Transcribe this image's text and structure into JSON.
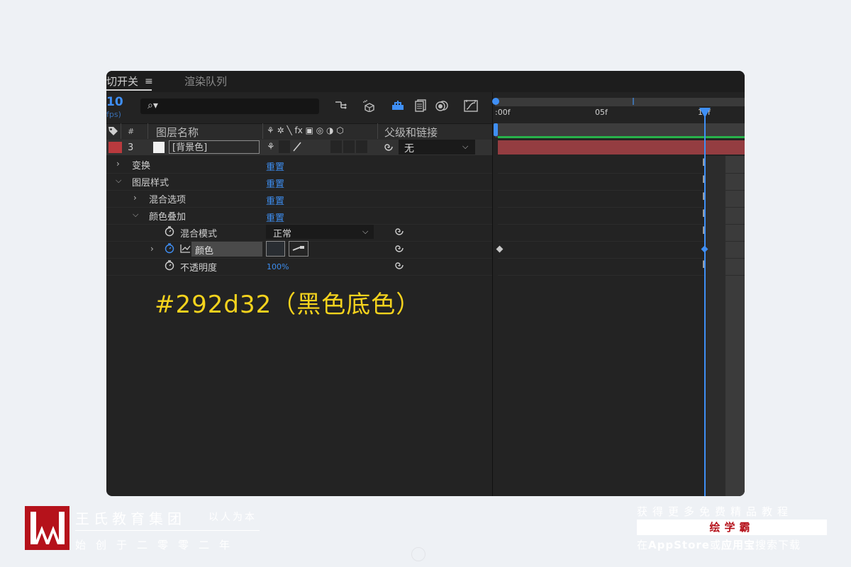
{
  "tabs": {
    "active_label": "切开关",
    "menu_glyph": "≡",
    "render_label": "渲染队列"
  },
  "timecode": {
    "value": "10",
    "fps": "fps)"
  },
  "search": {
    "glyph": "⌕▾"
  },
  "columns": {
    "label_icon": "tag-icon",
    "number": "#",
    "layer_name": "图层名称",
    "switches": "⚘ ✲ ╲ fx ▣ ◎ ◑ ⬡",
    "parent": "父级和链接"
  },
  "layer": {
    "index": "3",
    "name": "[背景色]",
    "parent_value": "无",
    "label_color": "#b93a3e"
  },
  "properties": [
    {
      "label": "变换",
      "reset": "重置"
    },
    {
      "label": "图层样式",
      "reset": "重置"
    },
    {
      "label": "混合选项",
      "reset": "重置"
    },
    {
      "label": "颜色叠加",
      "reset": "重置"
    },
    {
      "label": "混合模式",
      "value": "正常"
    },
    {
      "label": "颜色"
    },
    {
      "label": "不透明度",
      "value": "100%"
    }
  ],
  "timeline": {
    "ticks": [
      ":00f",
      "05f",
      "10f"
    ]
  },
  "caption": "#292d32（黑色底色）",
  "footer": {
    "brand_name": "王氏教育集团",
    "slogan": "以人为本",
    "since": "始创于二零零二年",
    "promo_line1": "获得更多免费精品教程",
    "promo_brand": "绘学霸",
    "promo_line3_pre": "在",
    "promo_line3_app": "AppStore",
    "promo_line3_mid": "或",
    "promo_line3_store": "应用宝",
    "promo_line3_post": "搜索下载"
  }
}
